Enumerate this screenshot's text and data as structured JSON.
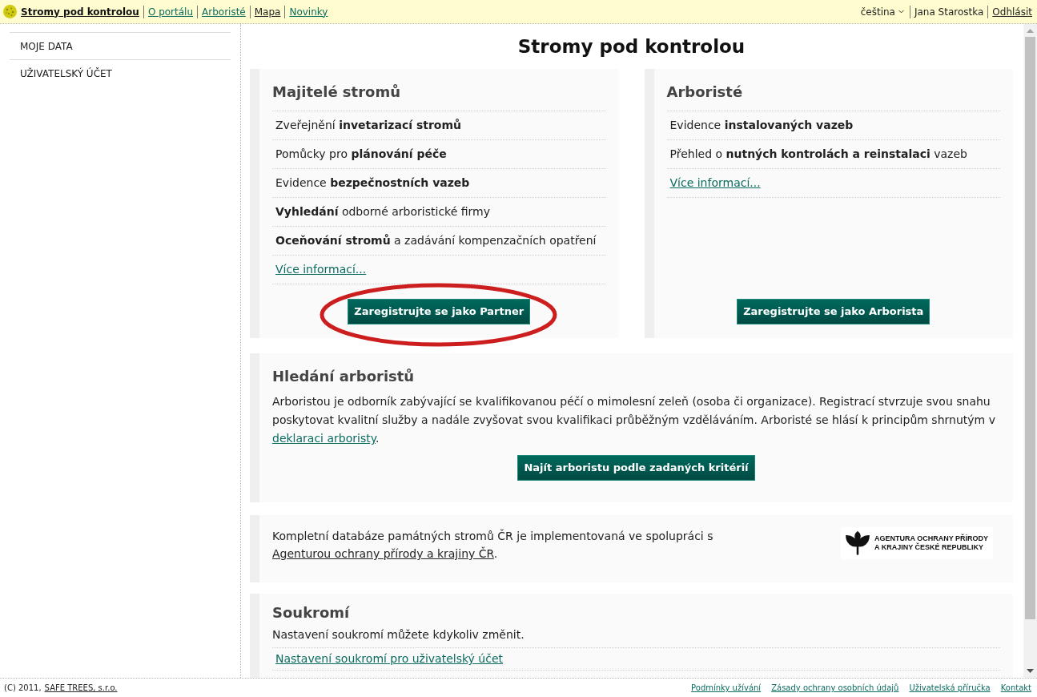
{
  "top_bar": {
    "site_title": "Stromy pod kontrolou",
    "nav_links": [
      {
        "label": "O portálu",
        "visited": false
      },
      {
        "label": "Arboristé",
        "visited": false
      },
      {
        "label": "Mapa",
        "visited": true
      },
      {
        "label": "Novinky",
        "visited": false
      }
    ],
    "language": "čeština",
    "user_name": "Jana Starostka",
    "logout": "Odhlásit"
  },
  "sidebar": {
    "items": [
      {
        "label": "MOJE DATA"
      },
      {
        "label": "UŽIVATELSKÝ ÚČET"
      }
    ]
  },
  "page_title": "Stromy pod kontrolou",
  "panels": [
    {
      "heading": "Majitelé stromů",
      "features": [
        "Zveřejnění **invetarizací stromů**",
        "Pomůcky pro **plánování péče**",
        "Evidence **bezpečnostních vazeb**",
        "**Vyhledání** odborné arboristické firmy",
        "**Oceňování stromů** a zadávání kompenzačních opatření"
      ],
      "more_link": "Více informací...",
      "button": {
        "label": "Zaregistrujte se jako Partner",
        "highlighted": true
      }
    },
    {
      "heading": "Arboristé",
      "features": [
        "Evidence **instalovaných vazeb**",
        "Přehled o **nutných kontrolách a reinstalaci** vazeb"
      ],
      "more_link": "Více informací...",
      "button": {
        "label": "Zaregistrujte se jako Arborista",
        "highlighted": false
      }
    }
  ],
  "search": {
    "heading": "Hledání arboristů",
    "text": "Arboristou je odborník zabývající se kvalifikovanou péčí o mimolesní zeleň (osoba či organizace). Registrací stvrzuje svou snahu poskytovat kvalitní služby a nadále zvyšovat svou kvalifikaci průběžným vzděláváním. Arboristé se hlásí k principům shrnutým v",
    "link": "deklaraci arboristy",
    "text_end": ".",
    "button": "Najít arboristu podle zadaných kritérií"
  },
  "agency": {
    "text": "Kompletní databáze památných stromů ČR je implementovaná ve spolupráci s",
    "link": "Agenturou ochrany přírody a krajiny ČR",
    "text_end": ".",
    "logo_lines": [
      "AGENTURA OCHRANY PŘÍRODY",
      "A KRAJINY ČESKÉ REPUBLIKY"
    ]
  },
  "privacy": {
    "heading": "Soukromí",
    "text": "Nastavení soukromí můžete kdykoliv změnit.",
    "links": [
      "Nastavení soukromí pro uživatelský účet"
    ]
  },
  "footer": {
    "copyright": "(C) 2011,",
    "company_link": "SAFE TREES, s.r.o.",
    "links": [
      "Podmínky užívání",
      "Zásady ochrany osobních údajů",
      "Uživatelská příručka",
      "Kontakt"
    ]
  }
}
